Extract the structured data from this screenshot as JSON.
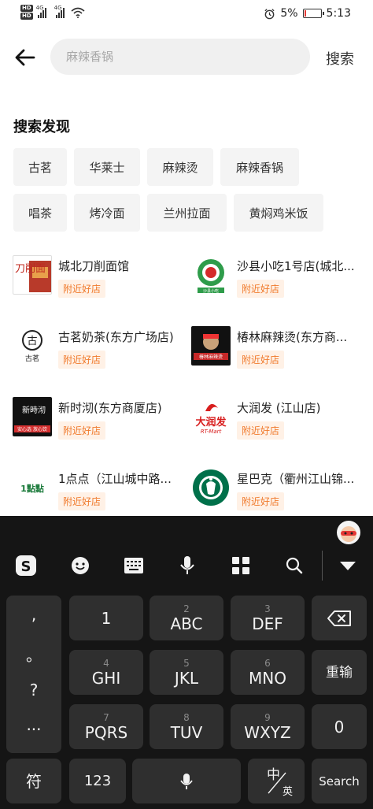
{
  "status_bar": {
    "sim1": "HD",
    "sim2": "HD",
    "net1": "4G",
    "net2": "4G",
    "battery_percent": "5%",
    "time": "5:13",
    "battery_level": 0.05,
    "battery_color": "#e53935"
  },
  "header": {
    "search_placeholder": "麻辣香锅",
    "search_button": "搜索"
  },
  "discover": {
    "title": "搜索发现",
    "chips": [
      "古茗",
      "华莱士",
      "麻辣烫",
      "麻辣香锅",
      "唱茶",
      "烤冷面",
      "兰州拉面",
      "黄焖鸡米饭"
    ]
  },
  "stores": [
    {
      "name": "城北刀削面馆",
      "tag": "附近好店",
      "logo_text": "刀削面"
    },
    {
      "name": "沙县小吃1号店(城北...",
      "tag": "附近好店",
      "logo_text": "沙县小吃"
    },
    {
      "name": "古茗奶茶(东方广场店)",
      "tag": "附近好店",
      "logo_text": "古茗"
    },
    {
      "name": "椿林麻辣烫(东方商...",
      "tag": "附近好店",
      "logo_text": "椿林麻辣烫"
    },
    {
      "name": "新时沏(东方商厦店)",
      "tag": "附近好店",
      "logo_text": "新時沏",
      "logo_sub": "安心选 放心饮"
    },
    {
      "name": "大润发 (江山店)",
      "tag": "附近好店",
      "logo_text": "大润发",
      "logo_sub": "RT-Mart"
    },
    {
      "name": "1点点（江山城中路...",
      "tag": "附近好店",
      "logo_text": "1點點"
    },
    {
      "name": "星巴克（衢州江山锦...",
      "tag": "附近好店",
      "logo_text": "starbucks"
    }
  ],
  "keyboard": {
    "punct": [
      ",",
      "。",
      "?",
      "..."
    ],
    "keys": [
      {
        "num": "",
        "main": "1"
      },
      {
        "num": "2",
        "main": "ABC"
      },
      {
        "num": "3",
        "main": "DEF"
      },
      {
        "num": "4",
        "main": "GHI"
      },
      {
        "num": "5",
        "main": "JKL"
      },
      {
        "num": "6",
        "main": "MNO"
      },
      {
        "num": "7",
        "main": "PQRS"
      },
      {
        "num": "8",
        "main": "TUV"
      },
      {
        "num": "9",
        "main": "WXYZ"
      }
    ],
    "reinput": "重输",
    "zero": "0",
    "symbol": "符",
    "num123": "123",
    "lang_zh": "中",
    "lang_en": "英",
    "search": "Search"
  },
  "icons": {
    "back": "back-arrow-icon",
    "sogou": "sogou-logo-icon",
    "emoji": "emoji-icon",
    "keyboard": "keyboard-icon",
    "mic": "microphone-icon",
    "apps": "apps-grid-icon",
    "search": "search-icon",
    "collapse": "collapse-keyboard-icon",
    "backspace": "backspace-icon"
  },
  "colors": {
    "tag_bg": "#fff1e6",
    "tag_text": "#f07a2c",
    "keyboard_bg": "#151515",
    "key_bg": "#2f2f2f"
  }
}
